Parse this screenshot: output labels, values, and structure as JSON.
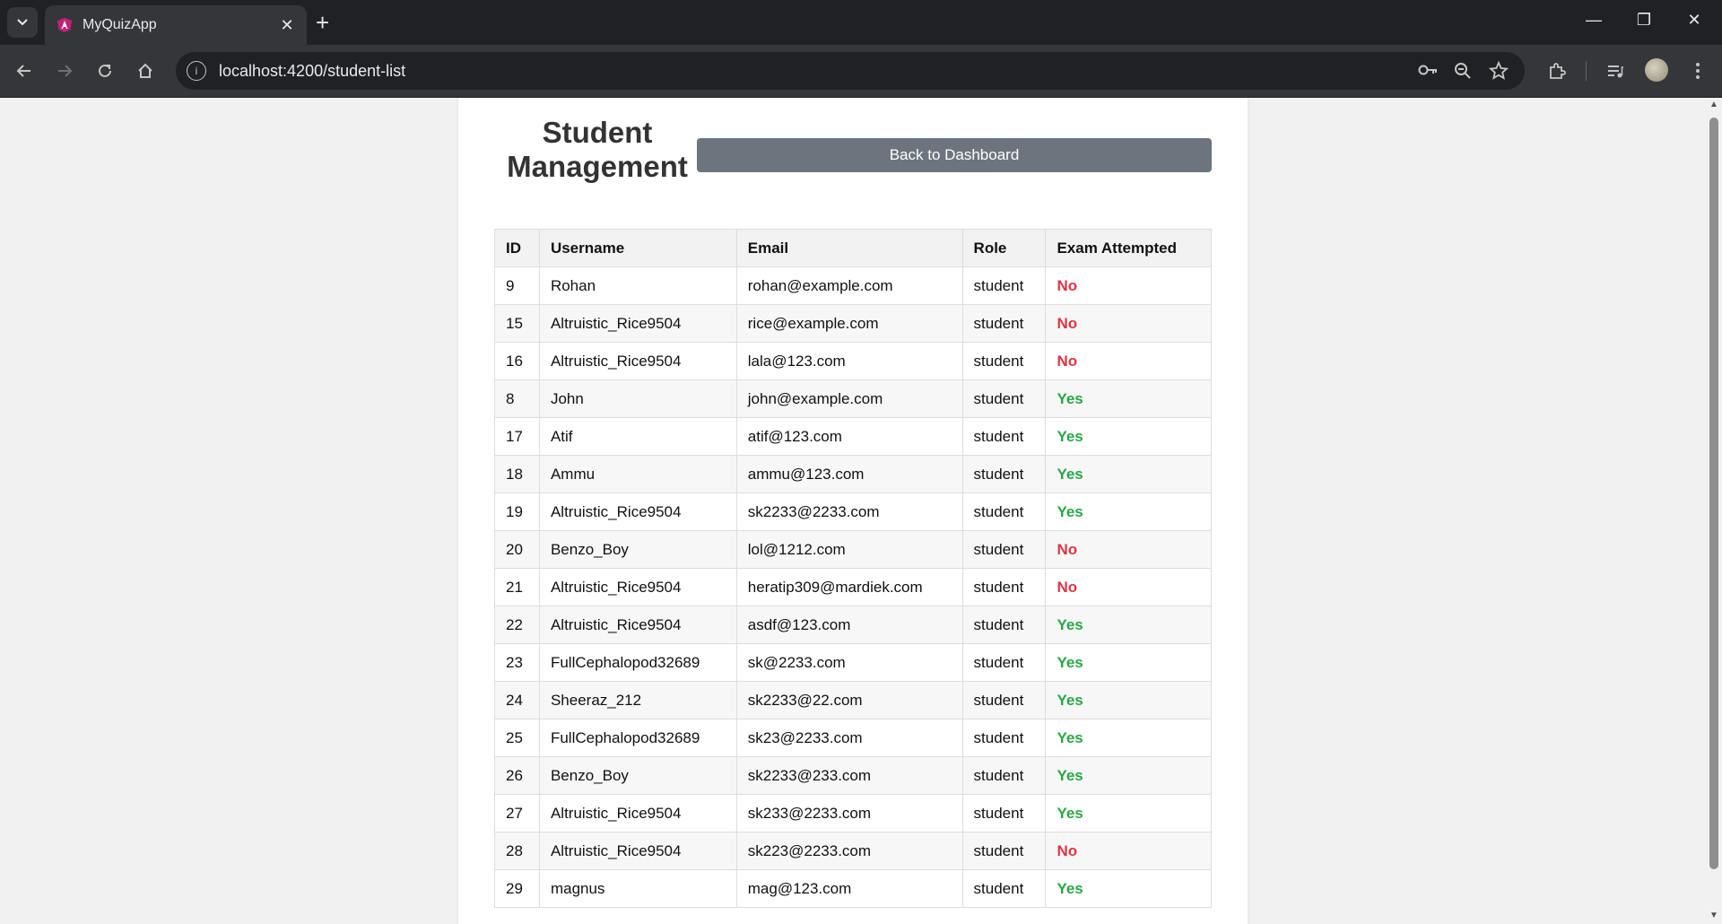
{
  "browser": {
    "tab_title": "MyQuizApp",
    "url": "localhost:4200/student-list"
  },
  "page": {
    "title": "Student Management",
    "back_button_label": "Back to Dashboard"
  },
  "table": {
    "headers": [
      "ID",
      "Username",
      "Email",
      "Role",
      "Exam Attempted"
    ],
    "rows": [
      {
        "id": "9",
        "username": "Rohan",
        "email": "rohan@example.com",
        "role": "student",
        "exam": "No"
      },
      {
        "id": "15",
        "username": "Altruistic_Rice9504",
        "email": "rice@example.com",
        "role": "student",
        "exam": "No"
      },
      {
        "id": "16",
        "username": "Altruistic_Rice9504",
        "email": "lala@123.com",
        "role": "student",
        "exam": "No"
      },
      {
        "id": "8",
        "username": "John",
        "email": "john@example.com",
        "role": "student",
        "exam": "Yes"
      },
      {
        "id": "17",
        "username": "Atif",
        "email": "atif@123.com",
        "role": "student",
        "exam": "Yes"
      },
      {
        "id": "18",
        "username": "Ammu",
        "email": "ammu@123.com",
        "role": "student",
        "exam": "Yes"
      },
      {
        "id": "19",
        "username": "Altruistic_Rice9504",
        "email": "sk2233@2233.com",
        "role": "student",
        "exam": "Yes"
      },
      {
        "id": "20",
        "username": "Benzo_Boy",
        "email": "lol@1212.com",
        "role": "student",
        "exam": "No"
      },
      {
        "id": "21",
        "username": "Altruistic_Rice9504",
        "email": "heratip309@mardiek.com",
        "role": "student",
        "exam": "No"
      },
      {
        "id": "22",
        "username": "Altruistic_Rice9504",
        "email": "asdf@123.com",
        "role": "student",
        "exam": "Yes"
      },
      {
        "id": "23",
        "username": "FullCephalopod32689",
        "email": "sk@2233.com",
        "role": "student",
        "exam": "Yes"
      },
      {
        "id": "24",
        "username": "Sheeraz_212",
        "email": "sk2233@22.com",
        "role": "student",
        "exam": "Yes"
      },
      {
        "id": "25",
        "username": "FullCephalopod32689",
        "email": "sk23@2233.com",
        "role": "student",
        "exam": "Yes"
      },
      {
        "id": "26",
        "username": "Benzo_Boy",
        "email": "sk2233@233.com",
        "role": "student",
        "exam": "Yes"
      },
      {
        "id": "27",
        "username": "Altruistic_Rice9504",
        "email": "sk233@2233.com",
        "role": "student",
        "exam": "Yes"
      },
      {
        "id": "28",
        "username": "Altruistic_Rice9504",
        "email": "sk223@2233.com",
        "role": "student",
        "exam": "No"
      },
      {
        "id": "29",
        "username": "magnus",
        "email": "mag@123.com",
        "role": "student",
        "exam": "Yes"
      }
    ]
  },
  "colors": {
    "exam_yes": "#28a745",
    "exam_no": "#dc3545",
    "back_button": "#6c757d"
  },
  "icons": [
    "tab-list-icon",
    "angular-favicon-icon",
    "close-icon",
    "plus-icon",
    "minimize-icon",
    "restore-icon",
    "back-arrow-icon",
    "forward-arrow-icon",
    "reload-icon",
    "home-icon",
    "info-icon",
    "key-icon",
    "zoom-icon",
    "star-icon",
    "extensions-icon",
    "media-icon",
    "profile-avatar",
    "more-vert-icon"
  ]
}
